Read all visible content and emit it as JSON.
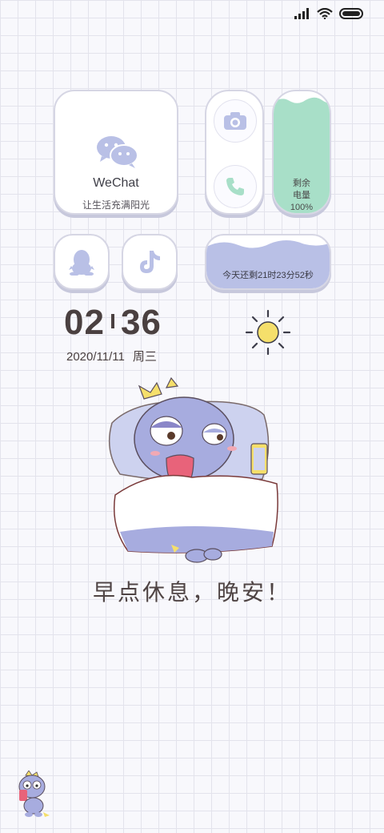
{
  "status_bar": {
    "icons": [
      "signal-icon",
      "wifi-icon",
      "battery-icon"
    ]
  },
  "wechat_widget": {
    "title": "WeChat",
    "subtitle": "让生活充满阳光",
    "icon": "wechat-icon"
  },
  "shortcuts": {
    "camera": "camera-icon",
    "phone": "phone-icon",
    "qq": "qq-icon",
    "tiktok": "tiktok-icon"
  },
  "battery_widget": {
    "line1": "剩余",
    "line2": "电量",
    "level": "100%",
    "fill_fraction": 1.0,
    "color": "#a8dfc8"
  },
  "countdown_widget": {
    "text": "今天还剩21时23分52秒",
    "color": "#b9c0e6"
  },
  "clock": {
    "hour": "02",
    "minute": "36",
    "date": "2020/11/11",
    "weekday": "周三"
  },
  "weather": {
    "icon": "sun-icon"
  },
  "message": {
    "text": "早点休息，晚安！"
  },
  "accent_colors": {
    "lavender": "#b9c0e6",
    "mint": "#a8dfc8",
    "yellow": "#f5df6b"
  }
}
